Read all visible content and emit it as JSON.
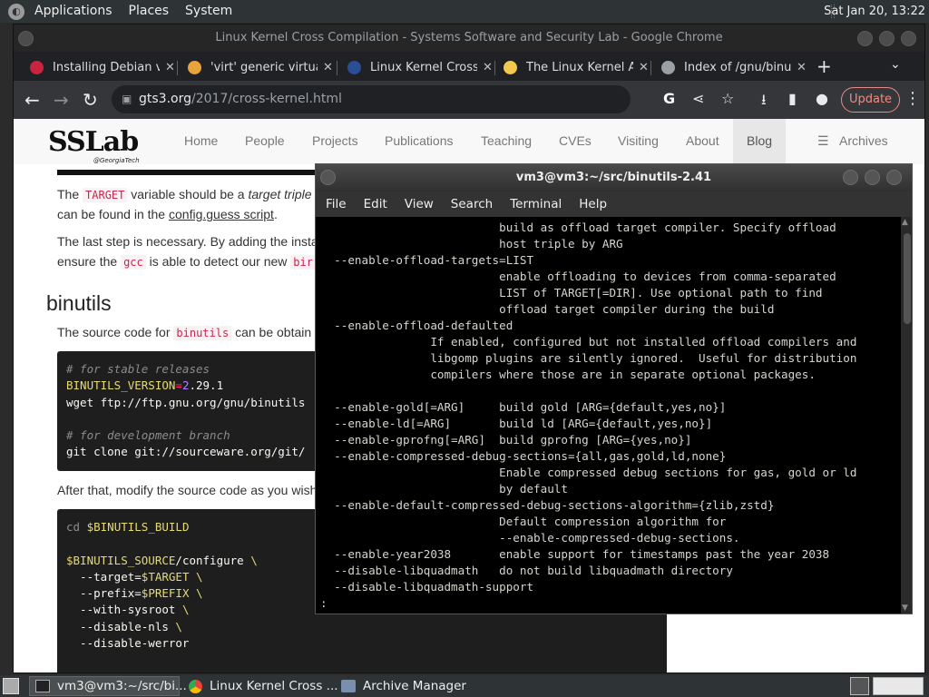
{
  "top_panel": {
    "menus": [
      "Applications",
      "Places",
      "System"
    ],
    "clock": "Sat Jan 20, 13:22"
  },
  "chrome": {
    "window_title": "Linux Kernel Cross Compilation - Systems Software and Security Lab - Google Chrome",
    "tabs": [
      {
        "label": "Installing Debian v",
        "fav_color": "#c9243f",
        "close": "✕"
      },
      {
        "label": "'virt' generic virtua",
        "fav_color": "#e8a33b",
        "close": "✕"
      },
      {
        "label": "Linux Kernel Cross",
        "fav_color": "#2a4e96",
        "close": "✕"
      },
      {
        "label": "The Linux Kernel A",
        "fav_color": "#f2c94c",
        "close": "✕"
      },
      {
        "label": "Index of /gnu/binut",
        "fav_color": "#9aa0a6",
        "close": "✕"
      }
    ],
    "new_tab": "+",
    "tab_search": "⌄",
    "url_host": "gts3.org",
    "url_path": "/2017/cross-kernel.html",
    "update_label": "Update",
    "icons": {
      "back": "←",
      "forward": "→",
      "reload": "↻",
      "lock": "🔒",
      "google": "G",
      "share": "⋖",
      "star": "☆",
      "ext": "⭳",
      "sidepanel": "▮",
      "profile": "●",
      "menu": "⋮"
    }
  },
  "site": {
    "logo": "SSLab",
    "logo_sub": "@GeorgiaTech",
    "nav": [
      "Home",
      "People",
      "Projects",
      "Publications",
      "Teaching",
      "CVEs",
      "Visiting",
      "About",
      "Blog"
    ],
    "archives": "Archives",
    "archives_icon": "☰",
    "p1_a": "The ",
    "p1_code": "TARGET",
    "p1_b": " variable should be a ",
    "p1_ital": "target triple",
    "p2_a": "can be found in the ",
    "p2_link": "config.guess script",
    "p2_b": ".",
    "p3": "The last step is necessary. By adding the insta",
    "p4_a": "ensure the ",
    "p4_code1": "gcc",
    "p4_b": " is able to detect our new ",
    "p4_code2": "bir",
    "heading": "binutils",
    "p5_a": "The source code for ",
    "p5_code": "binutils",
    "p5_b": " can be obtain",
    "p6": "After that, modify the source code as you wish"
  },
  "code1": {
    "comment1": "# for stable releases",
    "var_line_name": "BINUTILS_VERSION",
    "var_line_eq": "=",
    "var_line_num": "2",
    "var_line_rest": ".29.1",
    "wget": "wget ftp://ftp.gnu.org/gnu/binutils",
    "comment2": "# for development branch",
    "git": "git clone git://sourceware.org/git/"
  },
  "code2": {
    "cd_kw": "cd",
    "cd_var": " $BINUTILS_BUILD",
    "cfg_var": "$BINUTILS_SOURCE",
    "cfg_rest": "/configure ",
    "bs": "\\",
    "target_a": "  --target=",
    "target_var": "$TARGET",
    "prefix_a": "  --prefix=",
    "prefix_var": "$PREFIX",
    "sysroot": "  --with-sysroot ",
    "nls": "  --disable-nls ",
    "werror": "  --disable-werror"
  },
  "terminal": {
    "title": "vm3@vm3:~/src/binutils-2.41",
    "menu": [
      "File",
      "Edit",
      "View",
      "Search",
      "Terminal",
      "Help"
    ],
    "lines": [
      "                          build as offload target compiler. Specify offload",
      "                          host triple by ARG",
      "  --enable-offload-targets=LIST",
      "                          enable offloading to devices from comma-separated",
      "                          LIST of TARGET[=DIR]. Use optional path to find",
      "                          offload target compiler during the build",
      "  --enable-offload-defaulted",
      "                If enabled, configured but not installed offload compilers and",
      "                libgomp plugins are silently ignored.  Useful for distribution",
      "                compilers where those are in separate optional packages.",
      "",
      "  --enable-gold[=ARG]     build gold [ARG={default,yes,no}]",
      "  --enable-ld[=ARG]       build ld [ARG={default,yes,no}]",
      "  --enable-gprofng[=ARG]  build gprofng [ARG={yes,no}]",
      "  --enable-compressed-debug-sections={all,gas,gold,ld,none}",
      "                          Enable compressed debug sections for gas, gold or ld",
      "                          by default",
      "  --enable-default-compressed-debug-sections-algorithm={zlib,zstd}",
      "                          Default compression algorithm for",
      "                          --enable-compressed-debug-sections.",
      "  --enable-year2038       enable support for timestamps past the year 2038",
      "  --disable-libquadmath   do not build libquadmath directory",
      "  --disable-libquadmath-support",
      ":"
    ]
  },
  "taskbar": {
    "items": [
      "vm3@vm3:~/src/bi...",
      "Linux Kernel Cross ...",
      "Archive Manager"
    ]
  }
}
